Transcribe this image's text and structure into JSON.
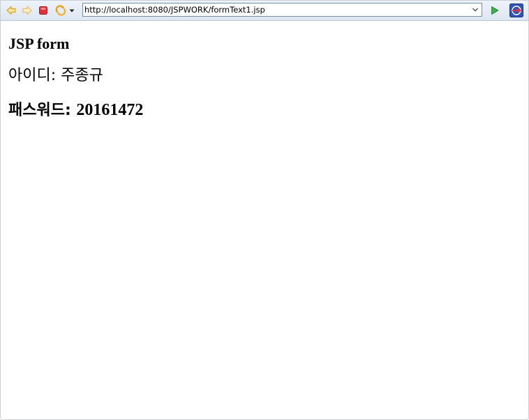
{
  "browser": {
    "url": "http://localhost:8080/JSPWORK/formText1.jsp",
    "icons": {
      "back": "back-arrow-icon",
      "forward": "forward-arrow-icon",
      "stop": "stop-icon",
      "refresh": "refresh-icon",
      "menu": "dropdown-arrow-icon",
      "go": "go-play-icon",
      "external": "open-external-icon"
    },
    "colors": {
      "back_forward": "#f2b13a",
      "stop": "#e0323a",
      "go": "#3bb04a",
      "external_bg": "#2e55b8"
    }
  },
  "page": {
    "title": "JSP form",
    "id_label": "아이디: ",
    "id_value": "주종규",
    "pw_label": "패스워드: ",
    "pw_value": "20161472"
  }
}
